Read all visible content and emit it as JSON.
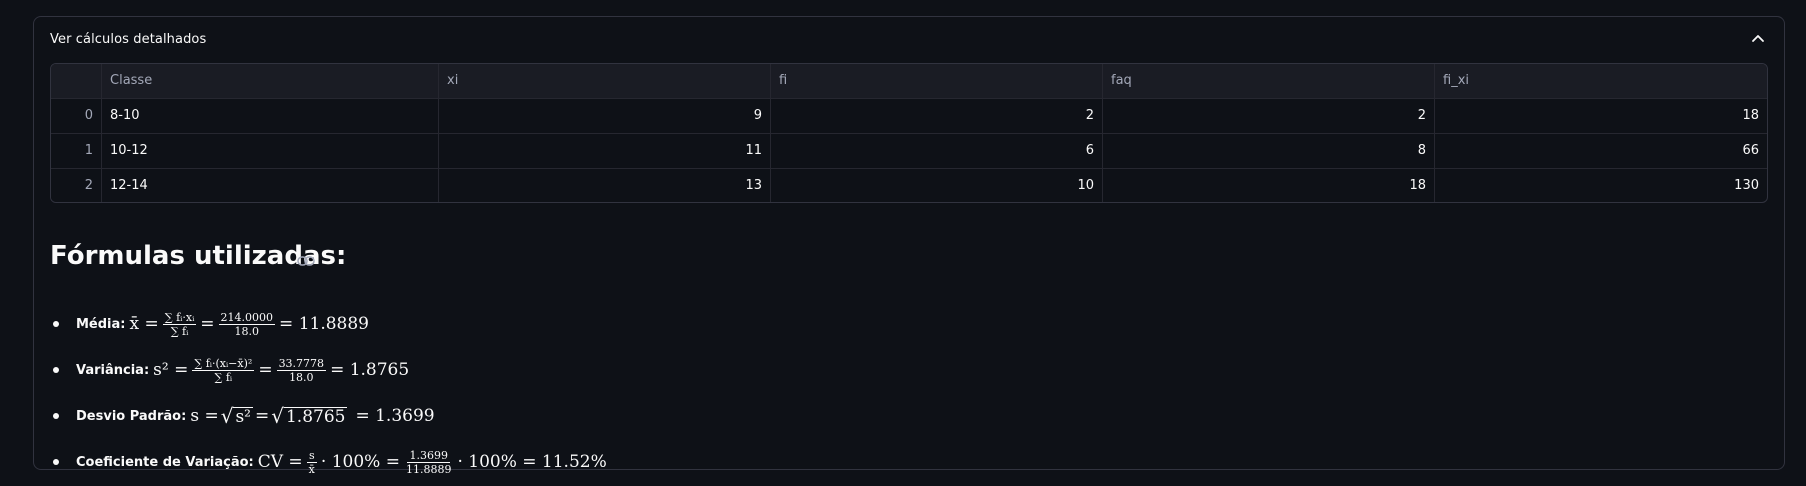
{
  "expander": {
    "title": "Ver cálculos detalhados",
    "chevron_icon": "chevron-up-icon"
  },
  "table": {
    "columns": [
      "",
      "Classe",
      "xi",
      "fi",
      "faq",
      "fi_xi"
    ],
    "rows": [
      {
        "index": "0",
        "classe": "8-10",
        "xi": "9",
        "fi": "2",
        "faq": "2",
        "fi_xi": "18"
      },
      {
        "index": "1",
        "classe": "10-12",
        "xi": "11",
        "fi": "6",
        "faq": "8",
        "fi_xi": "66"
      },
      {
        "index": "2",
        "classe": "12-14",
        "xi": "13",
        "fi": "10",
        "faq": "18",
        "fi_xi": "130"
      }
    ]
  },
  "formulas": {
    "title": "Fórmulas utilizadas:",
    "link_icon": "link-icon",
    "items": [
      {
        "label": "Média:",
        "lhs": "x̄ =",
        "frac1_num": "∑ fᵢ·xᵢ",
        "frac1_den": "∑ fᵢ",
        "frac2_num": "214.0000",
        "frac2_den": "18.0",
        "result": "= 11.8889"
      },
      {
        "label": "Variância:",
        "lhs": "s² =",
        "frac1_num": "∑ fᵢ·(xᵢ−x̄)²",
        "frac1_den": "∑ fᵢ",
        "frac2_num": "33.7778",
        "frac2_den": "18.0",
        "result": "= 1.8765"
      },
      {
        "label": "Desvio Padrão:",
        "lhs": "s =",
        "sqrt1": "s²",
        "sqrt2": "1.8765",
        "result": "= 1.3699"
      },
      {
        "label": "Coeficiente de Variação:",
        "lhs": "CV =",
        "frac1_num": "s",
        "frac1_den": "x̄",
        "mid": "· 100% =",
        "frac2_num": "1.3699",
        "frac2_den": "11.8889",
        "result": "· 100% = 11.52%"
      }
    ]
  }
}
